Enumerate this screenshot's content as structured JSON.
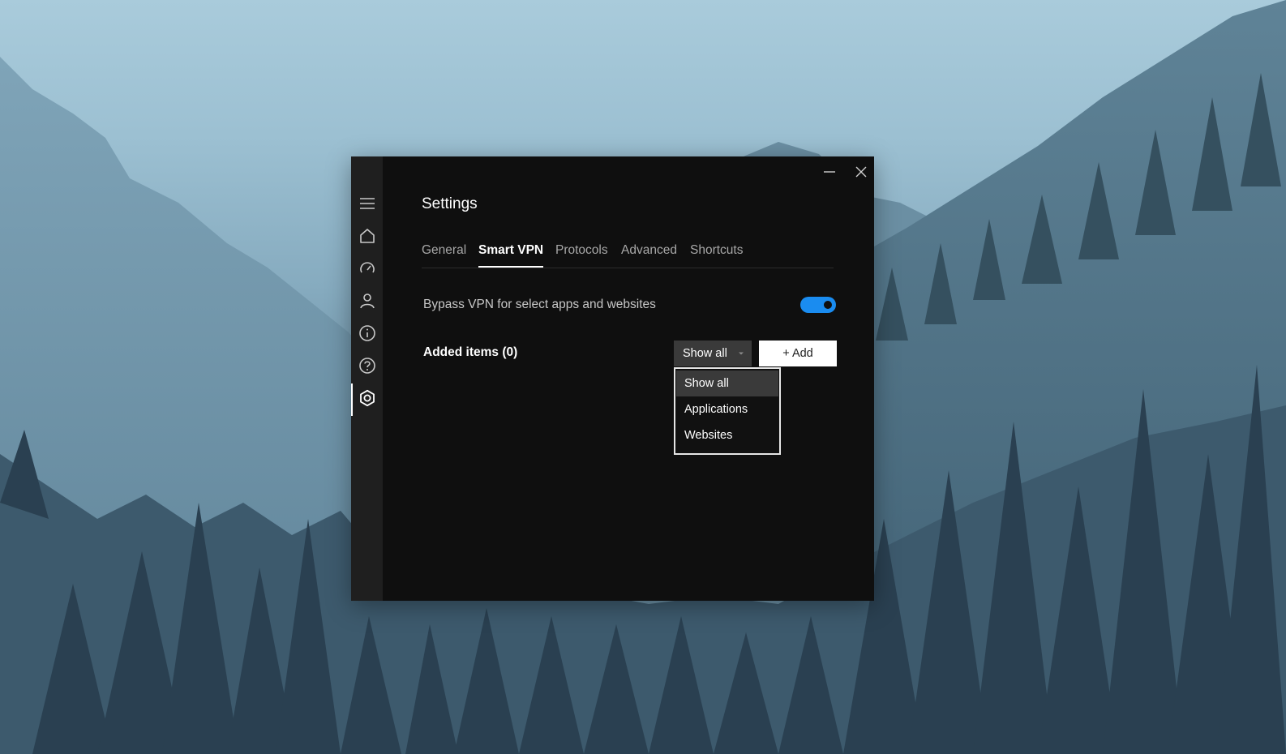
{
  "window": {
    "title": "Settings",
    "controls": {
      "minimize_icon": "minimize-icon",
      "close_icon": "close-icon"
    }
  },
  "sidebar": {
    "items": [
      {
        "name": "menu",
        "icon": "hamburger-menu-icon",
        "active": false
      },
      {
        "name": "home",
        "icon": "home-icon",
        "active": false
      },
      {
        "name": "speed",
        "icon": "speedometer-icon",
        "active": false
      },
      {
        "name": "account",
        "icon": "user-icon",
        "active": false
      },
      {
        "name": "info",
        "icon": "info-icon",
        "active": false
      },
      {
        "name": "help",
        "icon": "help-icon",
        "active": false
      },
      {
        "name": "settings",
        "icon": "settings-gear-icon",
        "active": true
      }
    ]
  },
  "tabs": [
    {
      "label": "General",
      "active": false
    },
    {
      "label": "Smart VPN",
      "active": true
    },
    {
      "label": "Protocols",
      "active": false
    },
    {
      "label": "Advanced",
      "active": false
    },
    {
      "label": "Shortcuts",
      "active": false
    }
  ],
  "bypass": {
    "label": "Bypass VPN for select apps and websites",
    "enabled": true
  },
  "added_items": {
    "label": "Added items (0)"
  },
  "filter": {
    "selected": "Show all",
    "options": [
      "Show all",
      "Applications",
      "Websites"
    ],
    "open": true
  },
  "add_button": {
    "label": "+ Add"
  },
  "colors": {
    "accent": "#1a8cf0",
    "window_bg": "#0f0f0f",
    "rail_bg": "#1f1f1f",
    "select_bg": "#3a3a3a"
  }
}
